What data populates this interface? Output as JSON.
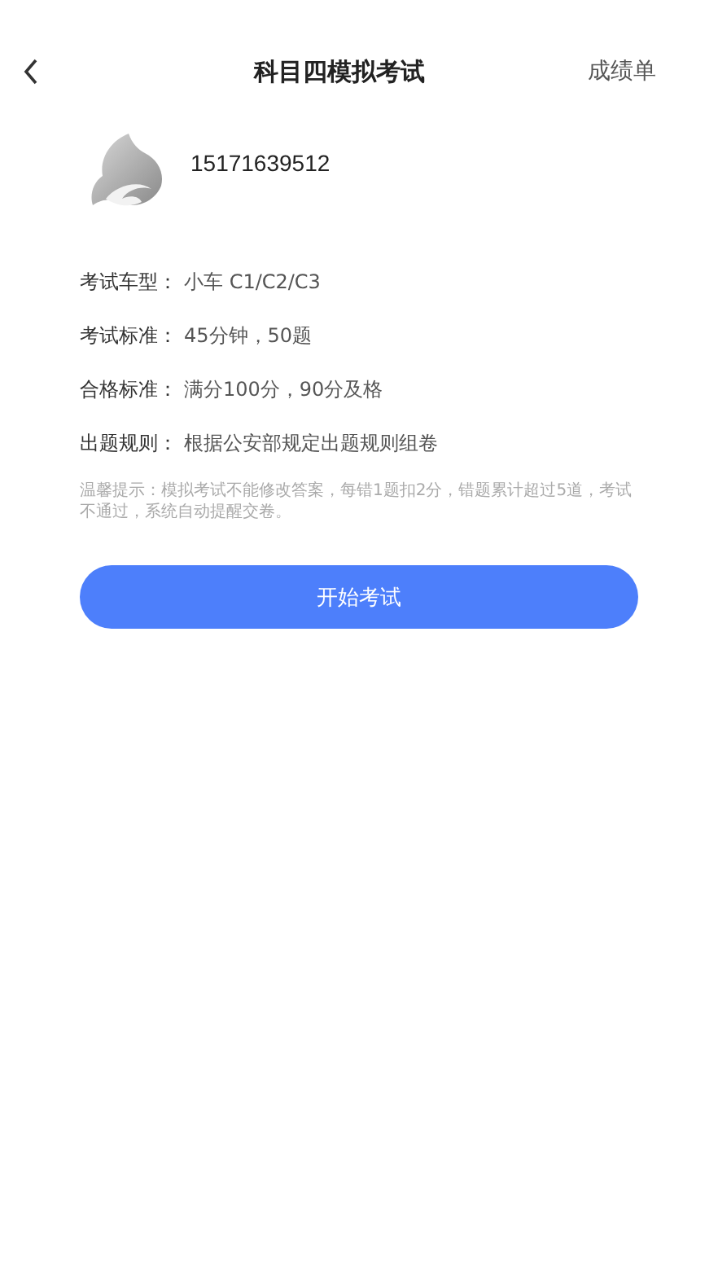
{
  "header": {
    "title": "科目四模拟考试",
    "action": "成绩单"
  },
  "user": {
    "phone": "15171639512"
  },
  "info_rows": [
    {
      "label": "考试车型：",
      "value": "小车 C1/C2/C3"
    },
    {
      "label": "考试标准：",
      "value": "45分钟，50题"
    },
    {
      "label": "合格标准：",
      "value": "满分100分，90分及格"
    },
    {
      "label": "出题规则：",
      "value": "根据公安部规定出题规则组卷"
    }
  ],
  "tip": "温馨提示：模拟考试不能修改答案，每错1题扣2分，错题累计超过5道，考试不通过，系统自动提醒交卷。",
  "start_button": "开始考试"
}
